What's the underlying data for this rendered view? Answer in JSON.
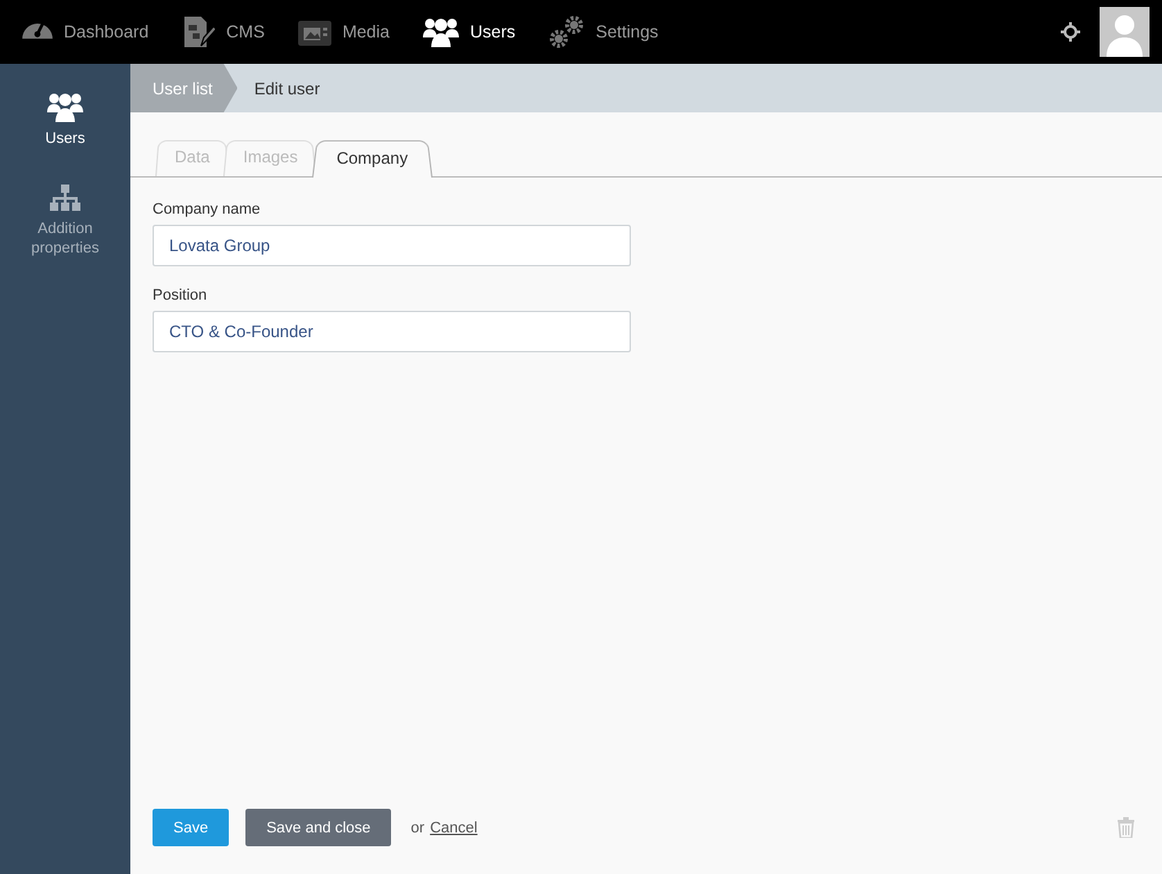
{
  "top_nav": {
    "items": [
      {
        "label": "Dashboard",
        "selected": false,
        "kind": "gauge"
      },
      {
        "label": "CMS",
        "selected": false,
        "kind": "document"
      },
      {
        "label": "Media",
        "selected": false,
        "kind": "camera"
      },
      {
        "label": "Users",
        "selected": true,
        "kind": "users"
      },
      {
        "label": "Settings",
        "selected": false,
        "kind": "gears"
      }
    ]
  },
  "sidebar": {
    "items": [
      {
        "label": "Users",
        "selected": true,
        "kind": "users"
      },
      {
        "label": "Addition properties",
        "selected": false,
        "kind": "tree"
      }
    ]
  },
  "breadcrumb": [
    "User list",
    "Edit user"
  ],
  "tabs": [
    {
      "label": "Data",
      "selected": false
    },
    {
      "label": "Images",
      "selected": false
    },
    {
      "label": "Company",
      "selected": true
    }
  ],
  "fields": [
    {
      "label": "Company name",
      "value": "Lovata Group"
    },
    {
      "label": "Position",
      "value": "CTO & Co-Founder"
    }
  ],
  "footer": {
    "save": "Save",
    "save_and_close": "Save and close",
    "or": "or",
    "cancel": "Cancel"
  }
}
